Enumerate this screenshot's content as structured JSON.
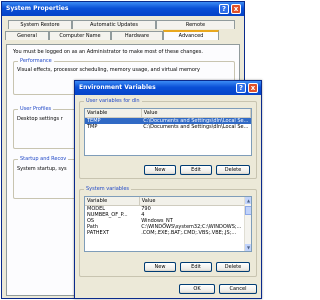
{
  "system_properties": {
    "title": "System Properties",
    "tabs_row1": [
      "System Restore",
      "Automatic Updates",
      "Remote"
    ],
    "tabs_row2": [
      "General",
      "Computer Name",
      "Hardware",
      "Advanced"
    ],
    "notice": "You must be logged on as an Administrator to make most of these changes.",
    "performance": {
      "title": "Performance",
      "text": "Visual effects, processor scheduling, memory usage, and virtual memory"
    },
    "user_profiles": {
      "title": "User Profiles",
      "text": "Desktop settings r"
    },
    "startup": {
      "title": "Startup and Recov",
      "text": "System startup, sys"
    },
    "buttons": {
      "close": "x",
      "help": "?"
    }
  },
  "env_vars": {
    "title": "Environment Variables",
    "user_group_title": "User variables for dln",
    "columns": [
      "Variable",
      "Value"
    ],
    "user_rows": [
      {
        "variable": "TEMP",
        "value": "C:\\Documents and Settings\\dln\\Local Se..."
      },
      {
        "variable": "TMP",
        "value": "C:\\Documents and Settings\\dln\\Local Se..."
      }
    ],
    "system_group_title": "System variables",
    "system_rows": [
      {
        "variable": "MODEL",
        "value": "790"
      },
      {
        "variable": "NUMBER_OF_P...",
        "value": "4"
      },
      {
        "variable": "OS",
        "value": "Windows_NT"
      },
      {
        "variable": "Path",
        "value": "C:\\WINDOWS\\system32;C:\\WINDOWS;..."
      },
      {
        "variable": "PATHEXT",
        "value": ".COM;.EXE;.BAT;.CMD;.VBS;.VBE;.JS;..."
      }
    ],
    "buttons": {
      "new": "New",
      "edit": "Edit",
      "delete": "Delete",
      "ok": "OK",
      "cancel": "Cancel",
      "close": "x",
      "help": "?"
    }
  },
  "colors": {
    "titlebar": "#0a4fd6",
    "dialog_bg": "#ece9d8",
    "selection": "#316ac5",
    "group_title": "#1f47c7"
  }
}
